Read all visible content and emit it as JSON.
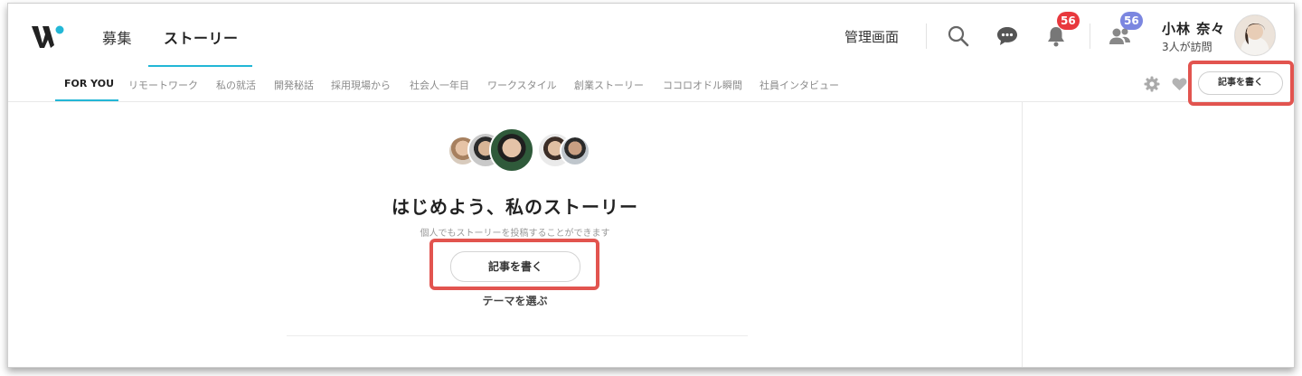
{
  "header": {
    "nav": [
      {
        "label": "募集"
      },
      {
        "label": "ストーリー"
      }
    ],
    "admin_label": "管理画面",
    "notifications_count": "56",
    "followers_count": "56",
    "user": {
      "name": "小林 奈々",
      "visits": "3人が訪問"
    }
  },
  "subnav": {
    "items": [
      "FOR YOU",
      "リモートワーク",
      "私の就活",
      "開発秘話",
      "採用現場から",
      "社会人一年目",
      "ワークスタイル",
      "創業ストーリー",
      "ココロオドル瞬間",
      "社員インタビュー"
    ],
    "write_label": "記事を書く"
  },
  "main": {
    "headline": "はじめよう、私のストーリー",
    "sub_text": "個人でもストーリーを投稿することができます",
    "write_label": "記事を書く",
    "theme_label": "テーマを選ぶ"
  },
  "colors": {
    "accent": "#23b7d6",
    "badge_red": "#e8383d",
    "badge_purple": "#7b86e0",
    "highlight": "#e2544f"
  },
  "icons": [
    "wantedly-logo",
    "search-icon",
    "chat-bubble-icon",
    "bell-icon",
    "people-icon",
    "gear-icon",
    "heart-icon"
  ]
}
